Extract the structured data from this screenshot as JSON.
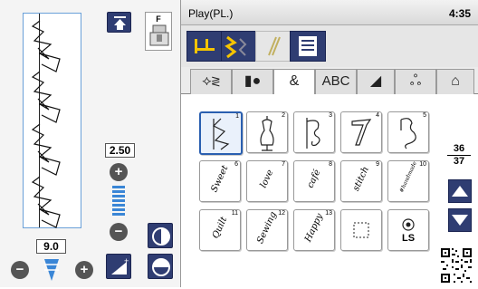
{
  "header": {
    "title": "Play(PL.)",
    "time": "4:35"
  },
  "left": {
    "presser_foot_label": "F",
    "width_value": "2.50",
    "length_value": "9.0",
    "plus": "+",
    "minus": "−"
  },
  "tabs": [
    {
      "name": "utility",
      "label": "⟡≷"
    },
    {
      "name": "buttonhole",
      "label": "▮●"
    },
    {
      "name": "decorative",
      "label": "&"
    },
    {
      "name": "alphabet",
      "label": "ABC"
    },
    {
      "name": "satin",
      "label": "◢"
    },
    {
      "name": "combine",
      "label": "ஃ"
    },
    {
      "name": "shirt",
      "label": "⌂"
    }
  ],
  "stitches": [
    {
      "num": "1",
      "word": ""
    },
    {
      "num": "2",
      "word": ""
    },
    {
      "num": "3",
      "word": ""
    },
    {
      "num": "4",
      "word": ""
    },
    {
      "num": "5",
      "word": ""
    },
    {
      "num": "6",
      "word": "Sweet"
    },
    {
      "num": "7",
      "word": "love"
    },
    {
      "num": "8",
      "word": "café"
    },
    {
      "num": "9",
      "word": "stitch"
    },
    {
      "num": "10",
      "word": "#handmade"
    },
    {
      "num": "11",
      "word": "Quilt"
    },
    {
      "num": "12",
      "word": "Sewing"
    },
    {
      "num": "13",
      "word": "Happy"
    },
    {
      "num": "",
      "word": ""
    },
    {
      "num": "",
      "word": "LS"
    }
  ],
  "pager": {
    "current": "36",
    "total": "37"
  },
  "colors": {
    "dark_button": "#2f3d72",
    "accent_blue": "#3a86d6",
    "selection": "#2a5fb0",
    "highlight_yellow": "#f5c400"
  }
}
